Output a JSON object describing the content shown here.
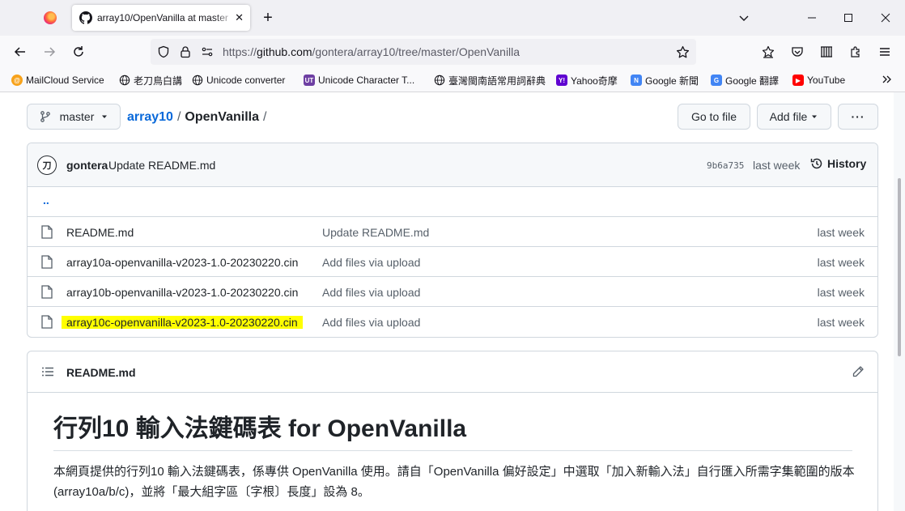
{
  "browser": {
    "tab_title": "array10/OpenVanilla at master",
    "url_prefix": "https://",
    "url_host": "github.com",
    "url_path": "/gontera/array10/tree/master/OpenVanilla"
  },
  "bookmarks": [
    {
      "label": "MailCloud Service",
      "icon": "mailcloud-icon"
    },
    {
      "label": "老刀鳥白講",
      "icon": "globe-icon"
    },
    {
      "label": "Unicode converter",
      "icon": "globe-icon"
    },
    {
      "label": "Unicode Character T...",
      "icon": "ut-icon"
    },
    {
      "label": "臺灣閩南語常用詞辭典",
      "icon": "globe-icon"
    },
    {
      "label": "Yahoo奇摩",
      "icon": "yahoo-icon"
    },
    {
      "label": "Google 新聞",
      "icon": "google-news-icon"
    },
    {
      "label": "Google 翻譯",
      "icon": "google-translate-icon"
    },
    {
      "label": "YouTube",
      "icon": "youtube-icon"
    }
  ],
  "repo": {
    "branch": "master",
    "repo_name": "array10",
    "separator": "/",
    "folder": "OpenVanilla",
    "trailing": "/",
    "go_to_file": "Go to file",
    "add_file": "Add file",
    "more": "···"
  },
  "commit": {
    "avatar": "刀",
    "user": "gontera",
    "message": "Update README.md",
    "sha": "9b6a735",
    "time": "last week",
    "history": "History"
  },
  "files": {
    "parent": "..",
    "rows": [
      {
        "name": "README.md",
        "message": "Update README.md",
        "time": "last week"
      },
      {
        "name": "array10a-openvanilla-v2023-1.0-20230220.cin",
        "message": "Add files via upload",
        "time": "last week"
      },
      {
        "name": "array10b-openvanilla-v2023-1.0-20230220.cin",
        "message": "Add files via upload",
        "time": "last week"
      },
      {
        "name": "array10c-openvanilla-v2023-1.0-20230220.cin",
        "message": "Add files via upload",
        "time": "last week"
      }
    ]
  },
  "readme": {
    "file": "README.md",
    "heading": "行列10 輸入法鍵碼表 for OpenVanilla",
    "paragraph": "本網頁提供的行列10 輸入法鍵碼表，係專供 OpenVanilla 使用。請自「OpenVanilla 偏好設定」中選取「加入新輸入法」自行匯入所需字集範圍的版本 (array10a/b/c)，並將「最大組字區〔字根〕長度」設為 8。"
  },
  "colors": {
    "link": "#0969da",
    "highlight": "#ffff00",
    "border": "#d0d7de"
  }
}
